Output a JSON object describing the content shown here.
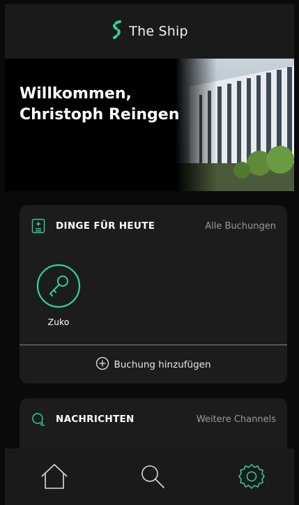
{
  "header": {
    "title": "The Ship",
    "logo_icon": "ship-logo-icon"
  },
  "hero": {
    "greeting_line1": "Willkommen,",
    "greeting_line2": "Christoph Reingen"
  },
  "today": {
    "title": "DINGE FÜR HEUTE",
    "link": "Alle Buchungen",
    "item_label": "Zuko",
    "item_icon": "key-icon",
    "add_label": "Buchung hinzufügen"
  },
  "messages": {
    "title": "NACHRICHTEN",
    "link": "Weitere Channels"
  },
  "tabs": [
    "home-icon",
    "search-icon",
    "settings-icon"
  ],
  "colors": {
    "accent": "#2ed39b",
    "background": "#0a0a0a",
    "card": "#1c1c1c"
  }
}
